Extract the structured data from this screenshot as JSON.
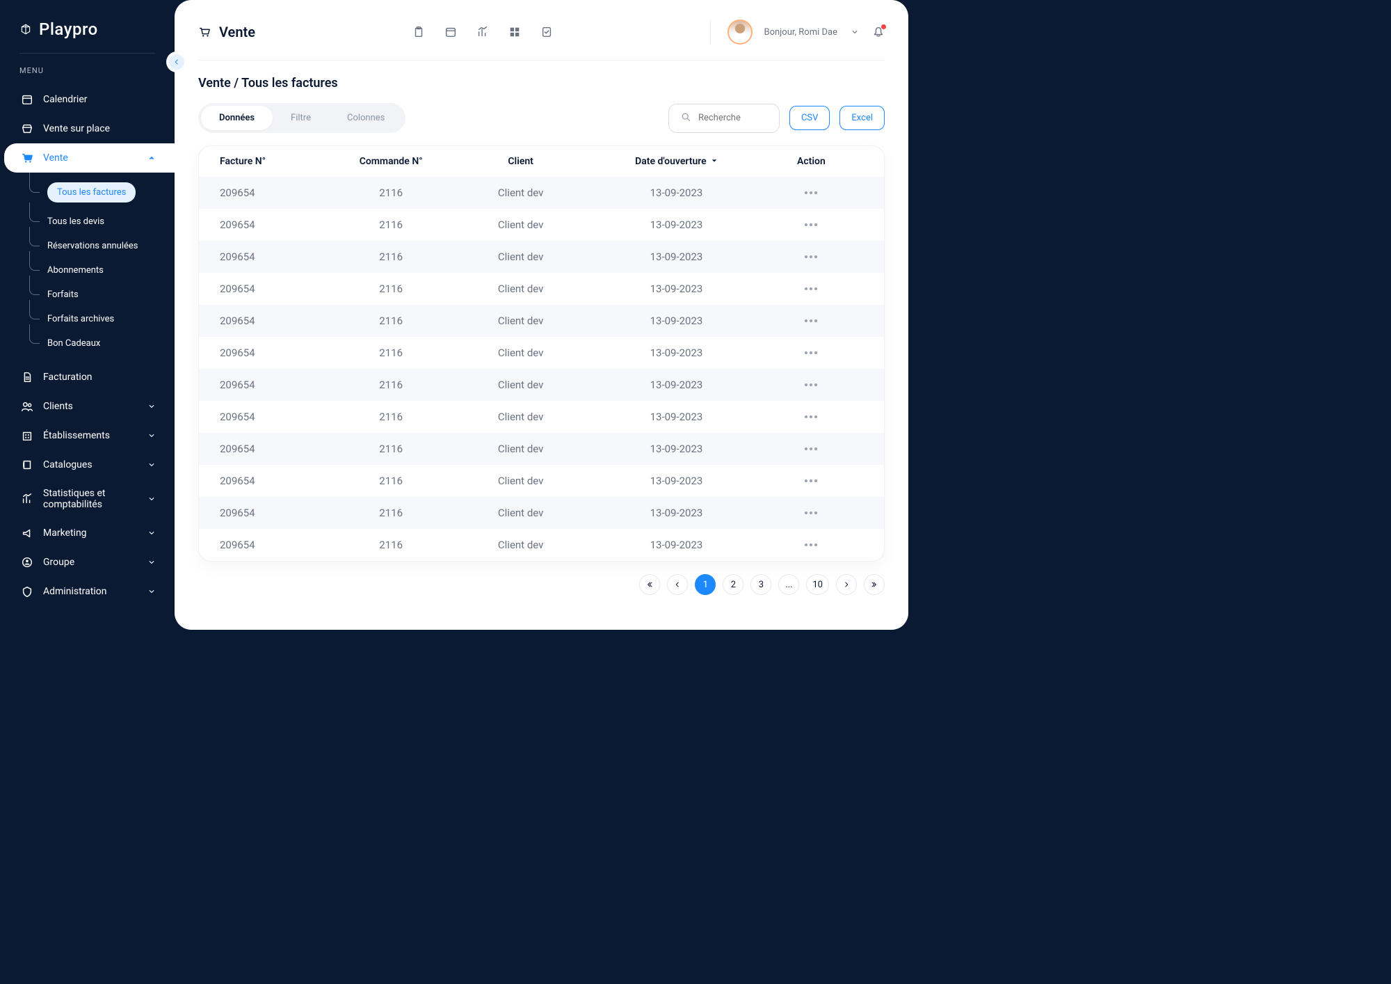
{
  "brand": "Playpro",
  "menuLabel": "MENU",
  "sidebar": {
    "items": [
      {
        "label": "Calendrier"
      },
      {
        "label": "Vente sur place"
      },
      {
        "label": "Vente"
      },
      {
        "label": "Facturation"
      },
      {
        "label": "Clients"
      },
      {
        "label": "Établissements"
      },
      {
        "label": "Catalogues"
      },
      {
        "label": "Statistiques et comptabilités"
      },
      {
        "label": "Marketing"
      },
      {
        "label": "Groupe"
      },
      {
        "label": "Administration"
      }
    ],
    "sub": [
      {
        "label": "Tous les factures"
      },
      {
        "label": "Tous les devis"
      },
      {
        "label": "Réservations annulées"
      },
      {
        "label": "Abonnements"
      },
      {
        "label": "Forfaits"
      },
      {
        "label": "Forfaits archives"
      },
      {
        "label": "Bon Cadeaux"
      }
    ]
  },
  "header": {
    "title": "Vente",
    "greeting": "Bonjour, Romi Dae"
  },
  "breadcrumb": "Vente / Tous les factures",
  "tabs": {
    "t1": "Données",
    "t2": "Filtre",
    "t3": "Colonnes"
  },
  "search": {
    "placeholder": "Recherche"
  },
  "export": {
    "csv": "CSV",
    "excel": "Excel"
  },
  "table": {
    "headers": {
      "c1": "Facture N°",
      "c2": "Commande N°",
      "c3": "Client",
      "c4": "Date d'ouverture",
      "c5": "Action"
    },
    "rows": [
      {
        "facture": "209654",
        "commande": "2116",
        "client": "Client dev",
        "date": "13-09-2023"
      },
      {
        "facture": "209654",
        "commande": "2116",
        "client": "Client dev",
        "date": "13-09-2023"
      },
      {
        "facture": "209654",
        "commande": "2116",
        "client": "Client dev",
        "date": "13-09-2023"
      },
      {
        "facture": "209654",
        "commande": "2116",
        "client": "Client dev",
        "date": "13-09-2023"
      },
      {
        "facture": "209654",
        "commande": "2116",
        "client": "Client dev",
        "date": "13-09-2023"
      },
      {
        "facture": "209654",
        "commande": "2116",
        "client": "Client dev",
        "date": "13-09-2023"
      },
      {
        "facture": "209654",
        "commande": "2116",
        "client": "Client dev",
        "date": "13-09-2023"
      },
      {
        "facture": "209654",
        "commande": "2116",
        "client": "Client dev",
        "date": "13-09-2023"
      },
      {
        "facture": "209654",
        "commande": "2116",
        "client": "Client dev",
        "date": "13-09-2023"
      },
      {
        "facture": "209654",
        "commande": "2116",
        "client": "Client dev",
        "date": "13-09-2023"
      },
      {
        "facture": "209654",
        "commande": "2116",
        "client": "Client dev",
        "date": "13-09-2023"
      },
      {
        "facture": "209654",
        "commande": "2116",
        "client": "Client dev",
        "date": "13-09-2023"
      }
    ]
  },
  "pagination": {
    "pages": [
      "1",
      "2",
      "3",
      "...",
      "10"
    ],
    "active": "1"
  }
}
